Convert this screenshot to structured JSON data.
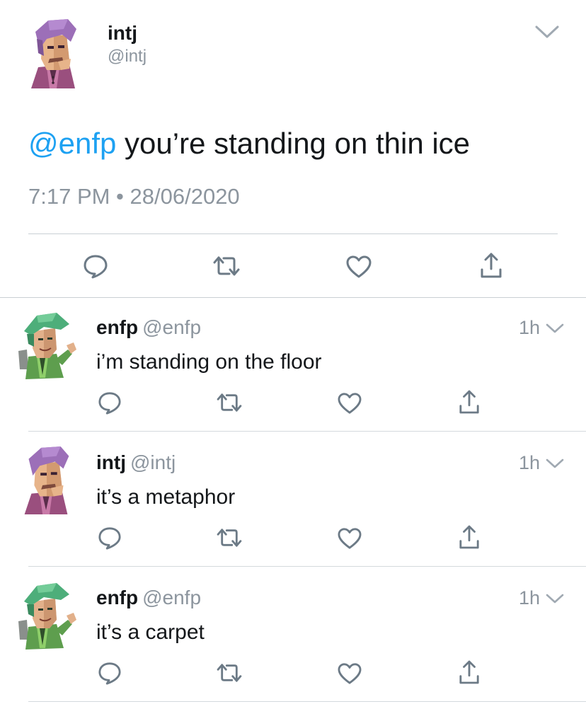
{
  "main_tweet": {
    "author_name": "intj",
    "author_handle": "@intj",
    "avatar": "intj-avatar",
    "mention": "@enfp",
    "text": " you’re standing on thin ice",
    "timestamp": "7:17 PM • 28/06/2020",
    "actions": [
      "reply-icon",
      "retweet-icon",
      "like-icon",
      "share-icon"
    ]
  },
  "replies": [
    {
      "author_name": "enfp",
      "author_handle": "@enfp",
      "avatar": "enfp-avatar",
      "time": "1h",
      "text": "i’m standing on the floor"
    },
    {
      "author_name": "intj",
      "author_handle": "@intj",
      "avatar": "intj-avatar",
      "time": "1h",
      "text": "it’s a metaphor"
    },
    {
      "author_name": "enfp",
      "author_handle": "@enfp",
      "avatar": "enfp-avatar",
      "time": "1h",
      "text": "it’s a carpet"
    }
  ],
  "colors": {
    "mention": "#1da1f2",
    "secondary_text": "#8c959e",
    "icon": "#6c7a86",
    "divider": "#c9cfd4"
  }
}
